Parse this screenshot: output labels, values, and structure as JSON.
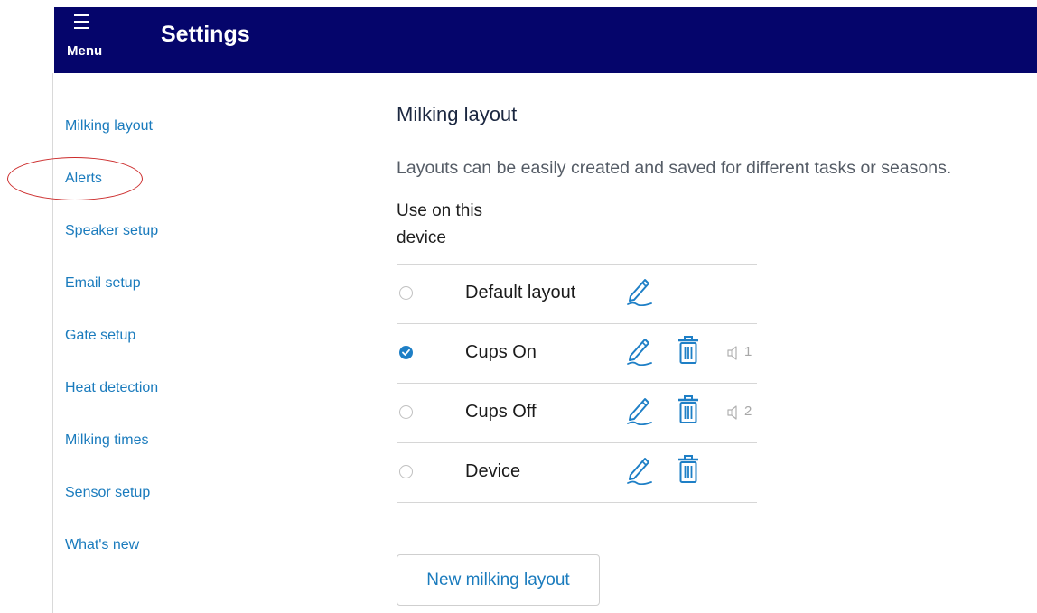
{
  "header": {
    "menu_label": "Menu",
    "title": "Settings",
    "background": "#05056b"
  },
  "sidebar": {
    "items": [
      {
        "label": "Milking layout"
      },
      {
        "label": "Alerts",
        "highlighted": true
      },
      {
        "label": "Speaker setup"
      },
      {
        "label": "Email setup"
      },
      {
        "label": "Gate setup"
      },
      {
        "label": "Heat detection"
      },
      {
        "label": "Milking times"
      },
      {
        "label": "Sensor setup"
      },
      {
        "label": "What's new"
      }
    ],
    "link_color": "#1a7bbd",
    "highlight_color": "#cc2b2b"
  },
  "main": {
    "title": "Milking layout",
    "description": "Layouts can be easily created and saved for different tasks or seasons.",
    "use_label": "Use on this device",
    "layouts": [
      {
        "name": "Default layout",
        "selected": false,
        "edit": true,
        "delete": false,
        "speaker": ""
      },
      {
        "name": "Cups On",
        "selected": true,
        "edit": true,
        "delete": true,
        "speaker": "1"
      },
      {
        "name": "Cups Off",
        "selected": false,
        "edit": true,
        "delete": true,
        "speaker": "2"
      },
      {
        "name": "Device",
        "selected": false,
        "edit": true,
        "delete": true,
        "speaker": ""
      }
    ],
    "new_button": "New milking layout",
    "accent": "#1e7fc6"
  }
}
